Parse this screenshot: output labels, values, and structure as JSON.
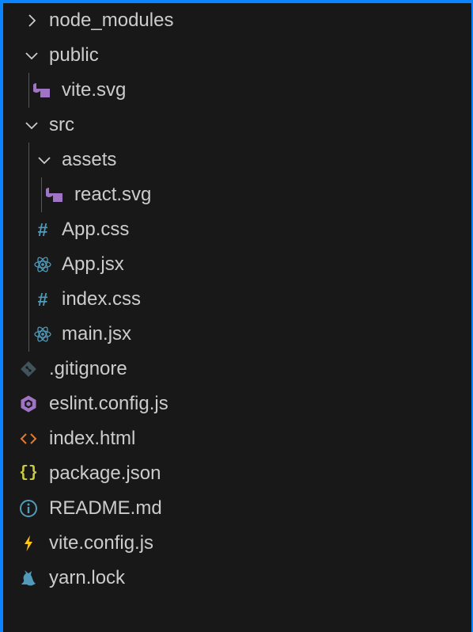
{
  "explorer": {
    "items": [
      {
        "label": "node_modules",
        "icon": "chevron-right-icon",
        "depth": 0
      },
      {
        "label": "public",
        "icon": "chevron-down-icon",
        "depth": 0
      },
      {
        "label": "vite.svg",
        "icon": "svg-file-icon",
        "depth": 1
      },
      {
        "label": "src",
        "icon": "chevron-down-icon",
        "depth": 0
      },
      {
        "label": "assets",
        "icon": "chevron-down-icon",
        "depth": 1
      },
      {
        "label": "react.svg",
        "icon": "svg-file-icon",
        "depth": 2
      },
      {
        "label": "App.css",
        "icon": "css-file-icon",
        "depth": 1
      },
      {
        "label": "App.jsx",
        "icon": "react-file-icon",
        "depth": 1
      },
      {
        "label": "index.css",
        "icon": "css-file-icon",
        "depth": 1
      },
      {
        "label": "main.jsx",
        "icon": "react-file-icon",
        "depth": 1
      },
      {
        "label": ".gitignore",
        "icon": "git-icon",
        "depth": 0
      },
      {
        "label": "eslint.config.js",
        "icon": "eslint-icon",
        "depth": 0
      },
      {
        "label": "index.html",
        "icon": "html-icon",
        "depth": 0
      },
      {
        "label": "package.json",
        "icon": "json-icon",
        "depth": 0
      },
      {
        "label": "README.md",
        "icon": "info-icon",
        "depth": 0
      },
      {
        "label": "vite.config.js",
        "icon": "vite-icon",
        "depth": 0
      },
      {
        "label": "yarn.lock",
        "icon": "yarn-icon",
        "depth": 0
      }
    ]
  },
  "colors": {
    "background": "#181818",
    "focus_border": "#0a84ff",
    "text": "#cccccc",
    "svg_icon": "#a074c4",
    "css_icon": "#519aba",
    "react_icon": "#519aba",
    "git_icon": "#41535b",
    "eslint_icon": "#a074c4",
    "html_icon": "#e37933",
    "json_icon": "#cbcb41",
    "info_icon": "#519aba",
    "vite_icon": "#ffc517",
    "yarn_icon": "#519aba"
  }
}
